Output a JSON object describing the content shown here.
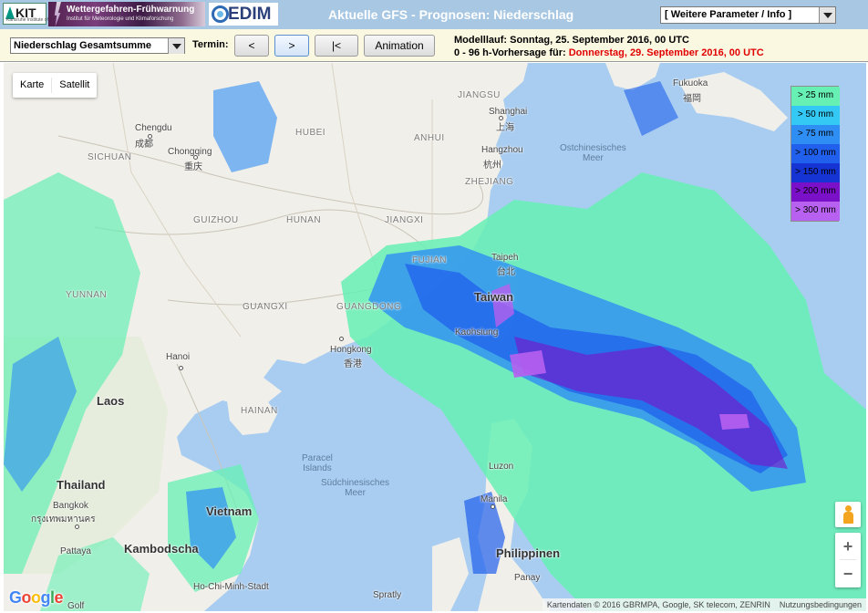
{
  "header": {
    "kit_logo_text": "KIT",
    "kit_logo_subtitle": "Karlsruhe Institute of Technology",
    "wfw_title": "Wettergefahren-Frühwarnung",
    "wfw_subtitle": "Institut für Meteorologie und Klimaforschung",
    "cedim_text": "EDIM",
    "title": "Aktuelle GFS - Prognosen: Niederschlag",
    "parameter_select": "[ Weitere Parameter / Info ]"
  },
  "toolbar": {
    "type_select": "Niederschlag Gesamtsumme",
    "termin_label": "Termin:",
    "prev_label": "<",
    "next_label": ">",
    "first_label": "|<",
    "animation_label": "Animation",
    "model_run": "Modelllauf: Sonntag, 25. September 2016, 00 UTC",
    "forecast_prefix": "0 - 96 h-Vorhersage für:",
    "forecast_date": "Donnerstag, 29. September 2016, 00 UTC"
  },
  "map": {
    "map_type": {
      "karte": "Karte",
      "satellit": "Satellit"
    },
    "legend": [
      {
        "label": "> 25 mm",
        "color": "#66f0b4"
      },
      {
        "label": "> 50 mm",
        "color": "#34c8f4"
      },
      {
        "label": "> 75 mm",
        "color": "#2f8ef4"
      },
      {
        "label": "> 100 mm",
        "color": "#2060ec"
      },
      {
        "label": "> 150 mm",
        "color": "#1634d4"
      },
      {
        "label": "> 200 mm",
        "color": "#7a10c8"
      },
      {
        "label": "> 300 mm",
        "color": "#b860ef"
      }
    ],
    "labels": {
      "chengdu": "Chengdu",
      "chengdu_cn": "成都",
      "sichuan": "SICHUAN",
      "chongqing": "Chongqing",
      "chongqing_cn": "重庆",
      "hubei": "HUBEI",
      "anhui": "ANHUI",
      "jiangsu": "JIANGSU",
      "shanghai": "Shanghai",
      "shanghai_cn": "上海",
      "hangzhou": "Hangzhou",
      "hangzhou_cn": "杭州",
      "zhejiang": "ZHEJIANG",
      "guizhou": "GUIZHOU",
      "hunan": "HUNAN",
      "jiangxi": "JIANGXI",
      "fujian": "FUJIAN",
      "taipei": "Taipeh",
      "taipei_cn": "台北",
      "taiwan": "Taiwan",
      "kaohsiung": "Kaohsiung",
      "yunnan": "YUNNAN",
      "guangxi": "GUANGXI",
      "guangdong": "GUANGDONG",
      "hongkong": "Hongkong",
      "hongkong_cn": "香港",
      "hanoi": "Hanoi",
      "hainan": "HAINAN",
      "laos": "Laos",
      "thailand": "Thailand",
      "bangkok": "Bangkok",
      "bangkok_local": "กรุงเทพมหานคร",
      "pattaya": "Pattaya",
      "vietnam": "Vietnam",
      "kambodscha": "Kambodscha",
      "hcmc": "Ho-Chi-Minh-Stadt",
      "paracel": "Paracel\nIslands",
      "suedchinesisches_meer": "Südchinesisches\nMeer",
      "ostchinesisches_meer": "Ostchinesisches\nMeer",
      "fukuoka": "Fukuoka",
      "fukuoka_cn": "福岡",
      "luzon": "Luzon",
      "manila": "Manila",
      "philippinen": "Philippinen",
      "panay": "Panay",
      "spratly": "Spratly",
      "golf": "Golf"
    },
    "attribution": "Kartendaten © 2016 GBRMPA, Google, SK telecom, ZENRIN",
    "terms": "Nutzungsbedingungen",
    "zoom_in": "+",
    "zoom_out": "−"
  }
}
